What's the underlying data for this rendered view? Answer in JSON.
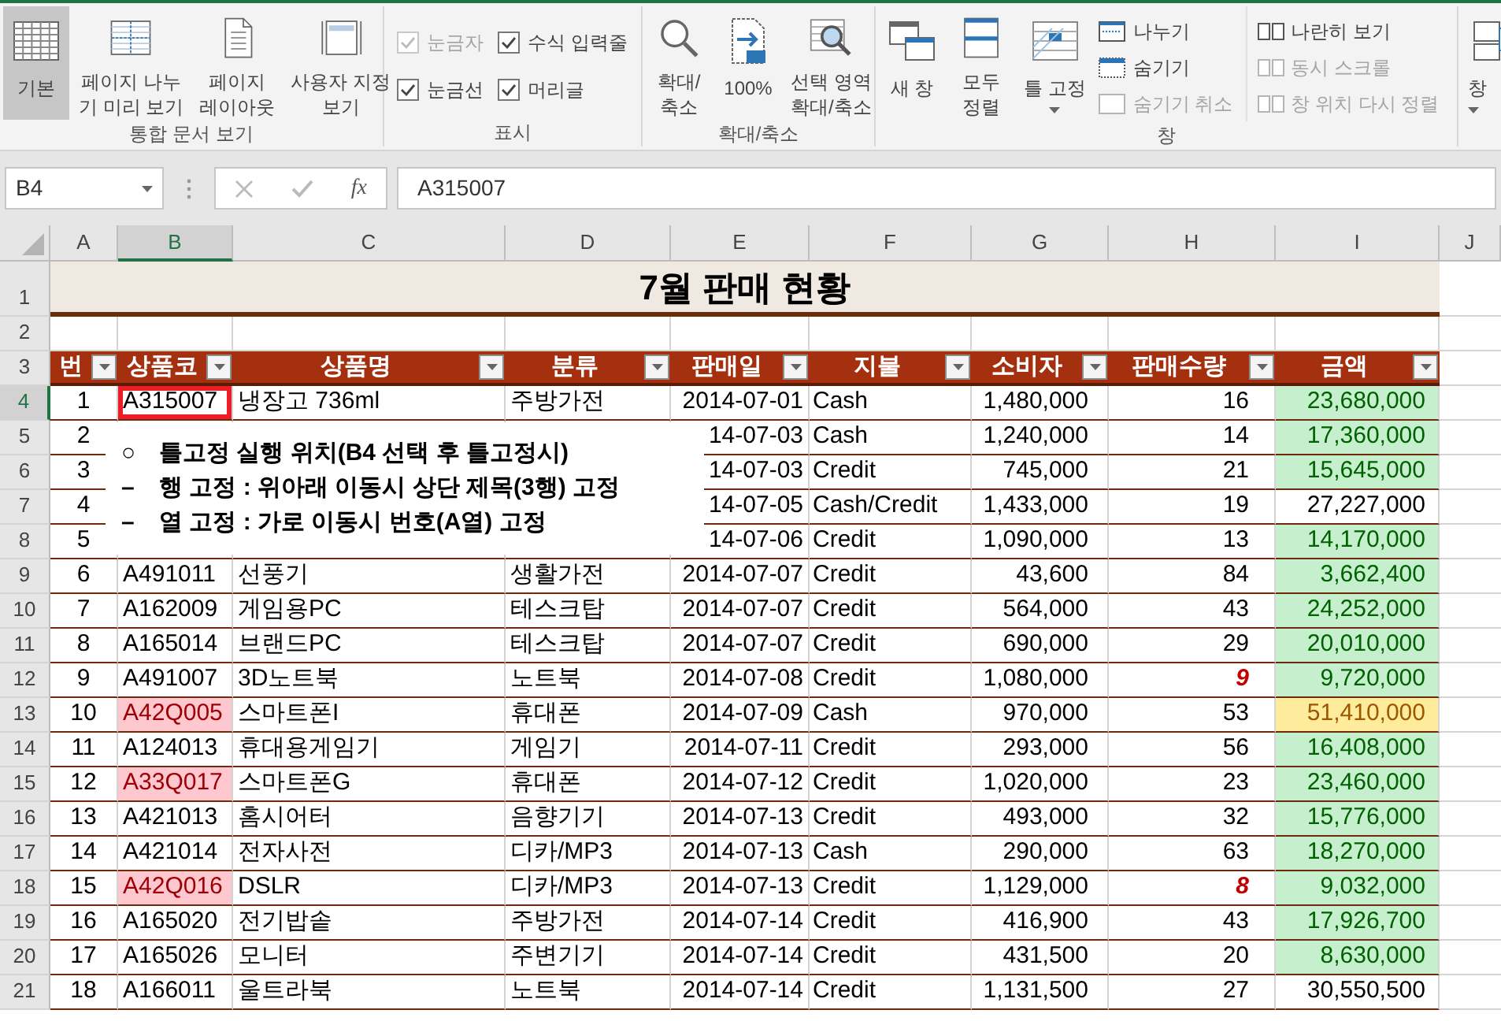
{
  "ribbon": {
    "groups": [
      {
        "label": "통합 문서 보기",
        "items": [
          {
            "kind": "large",
            "lines": [
              "기본"
            ],
            "selected": true,
            "has_menu": false
          },
          {
            "kind": "large",
            "lines": [
              "페이지 나누",
              "기 미리 보기"
            ],
            "selected": false,
            "has_menu": false
          },
          {
            "kind": "large",
            "lines": [
              "페이지",
              "레이아웃"
            ],
            "selected": false,
            "has_menu": false
          },
          {
            "kind": "large",
            "lines": [
              "사용자 지정",
              "보기"
            ],
            "selected": false,
            "has_menu": false
          }
        ]
      },
      {
        "label": "표시",
        "items": [
          {
            "kind": "check",
            "label": "눈금자",
            "checked": true,
            "disabled": true
          },
          {
            "kind": "check",
            "label": "수식 입력줄",
            "checked": true,
            "disabled": false
          },
          {
            "kind": "check",
            "label": "눈금선",
            "checked": true,
            "disabled": false
          },
          {
            "kind": "check",
            "label": "머리글",
            "checked": true,
            "disabled": false
          }
        ]
      },
      {
        "label": "확대/축소",
        "items": [
          {
            "kind": "large",
            "lines": [
              "확대/",
              "축소"
            ],
            "selected": false,
            "has_menu": false
          },
          {
            "kind": "large",
            "lines": [
              "100%"
            ],
            "selected": false,
            "has_menu": false
          },
          {
            "kind": "large",
            "lines": [
              "선택 영역",
              "확대/축소"
            ],
            "selected": false,
            "has_menu": false
          }
        ]
      },
      {
        "label": "창",
        "items": [
          {
            "kind": "large",
            "lines": [
              "새 창"
            ],
            "selected": false,
            "has_menu": false
          },
          {
            "kind": "large",
            "lines": [
              "모두",
              "정렬"
            ],
            "selected": false,
            "has_menu": false
          },
          {
            "kind": "large",
            "lines": [
              "틀 고정"
            ],
            "selected": false,
            "has_menu": true
          },
          {
            "kind": "small",
            "label": "나누기",
            "disabled": false
          },
          {
            "kind": "small",
            "label": "숨기기",
            "disabled": false
          },
          {
            "kind": "small",
            "label": "숨기기 취소",
            "disabled": true
          },
          {
            "kind": "small",
            "label": "나란히 보기",
            "disabled": false
          },
          {
            "kind": "small",
            "label": "동시 스크롤",
            "disabled": true
          },
          {
            "kind": "small",
            "label": "창 위치 다시 정렬",
            "disabled": true
          }
        ]
      },
      {
        "items": [
          {
            "kind": "large",
            "lines": [
              "창"
            ],
            "selected": false,
            "has_menu": true
          }
        ]
      }
    ]
  },
  "formula_bar": {
    "name_box": "B4",
    "insert_function": "fx",
    "value": "A315007"
  },
  "sheet": {
    "columns": [
      {
        "label": "A",
        "selected": false
      },
      {
        "label": "B",
        "selected": true
      },
      {
        "label": "C",
        "selected": false
      },
      {
        "label": "D",
        "selected": false
      },
      {
        "label": "E",
        "selected": false
      },
      {
        "label": "F",
        "selected": false
      },
      {
        "label": "G",
        "selected": false
      },
      {
        "label": "H",
        "selected": false
      },
      {
        "label": "I",
        "selected": false
      },
      {
        "label": "J",
        "selected": false
      }
    ],
    "title_row": {
      "row": "1",
      "title": "7월 판매 현황"
    },
    "blank_row": {
      "row": "2"
    },
    "header_row": {
      "row": "3",
      "headers": [
        "번",
        "상품코",
        "상품명",
        "분류",
        "판매일",
        "지불",
        "소비자",
        "판매수량",
        "금액"
      ]
    },
    "rows": [
      {
        "row": "4",
        "selected": true,
        "no": "1",
        "code": "A315007",
        "name": "냉장고 736ml",
        "category": "주방가전",
        "date": "2014-07-01",
        "payment": "Cash",
        "price": "1,480,000",
        "qty": "16",
        "amount": "23,680,000",
        "code_selected": true,
        "code_flagged": false,
        "qty_low": false,
        "amount_ok": true,
        "amount_top": false
      },
      {
        "row": "5",
        "selected": false,
        "no": "2",
        "date": "14-07-03",
        "payment": "Cash",
        "price": "1,240,000",
        "qty": "14",
        "amount": "17,360,000",
        "qty_low": false,
        "amount_ok": true,
        "amount_top": false
      },
      {
        "row": "6",
        "selected": false,
        "no": "3",
        "date": "14-07-03",
        "payment": "Credit",
        "price": "745,000",
        "qty": "21",
        "amount": "15,645,000",
        "qty_low": false,
        "amount_ok": true,
        "amount_top": false
      },
      {
        "row": "7",
        "selected": false,
        "no": "4",
        "date": "14-07-05",
        "payment": "Cash/Credit",
        "price": "1,433,000",
        "qty": "19",
        "amount": "27,227,000",
        "qty_low": false,
        "amount_ok": false,
        "amount_top": false
      },
      {
        "row": "8",
        "selected": false,
        "no": "5",
        "date": "14-07-06",
        "payment": "Credit",
        "price": "1,090,000",
        "qty": "13",
        "amount": "14,170,000",
        "qty_low": false,
        "amount_ok": true,
        "amount_top": false
      },
      {
        "row": "9",
        "selected": false,
        "no": "6",
        "code": "A491011",
        "name": "선풍기",
        "category": "생활가전",
        "date": "2014-07-07",
        "payment": "Credit",
        "price": "43,600",
        "qty": "84",
        "amount": "3,662,400",
        "code_selected": false,
        "code_flagged": false,
        "qty_low": false,
        "amount_ok": true,
        "amount_top": false
      },
      {
        "row": "10",
        "selected": false,
        "no": "7",
        "code": "A162009",
        "name": "게임용PC",
        "category": "테스크탑",
        "date": "2014-07-07",
        "payment": "Credit",
        "price": "564,000",
        "qty": "43",
        "amount": "24,252,000",
        "code_selected": false,
        "code_flagged": false,
        "qty_low": false,
        "amount_ok": true,
        "amount_top": false
      },
      {
        "row": "11",
        "selected": false,
        "no": "8",
        "code": "A165014",
        "name": "브랜드PC",
        "category": "테스크탑",
        "date": "2014-07-07",
        "payment": "Credit",
        "price": "690,000",
        "qty": "29",
        "amount": "20,010,000",
        "code_selected": false,
        "code_flagged": false,
        "qty_low": false,
        "amount_ok": true,
        "amount_top": false
      },
      {
        "row": "12",
        "selected": false,
        "no": "9",
        "code": "A491007",
        "name": "3D노트북",
        "category": "노트북",
        "date": "2014-07-08",
        "payment": "Credit",
        "price": "1,080,000",
        "qty": "9",
        "amount": "9,720,000",
        "code_selected": false,
        "code_flagged": false,
        "qty_low": true,
        "amount_ok": true,
        "amount_top": false
      },
      {
        "row": "13",
        "selected": false,
        "no": "10",
        "code": "A42Q005",
        "name": "스마트폰I",
        "category": "휴대폰",
        "date": "2014-07-09",
        "payment": "Cash",
        "price": "970,000",
        "qty": "53",
        "amount": "51,410,000",
        "code_selected": false,
        "code_flagged": true,
        "qty_low": false,
        "amount_top": true
      },
      {
        "row": "14",
        "selected": false,
        "no": "11",
        "code": "A124013",
        "name": "휴대용게임기",
        "category": "게임기",
        "date": "2014-07-11",
        "payment": "Credit",
        "price": "293,000",
        "qty": "56",
        "amount": "16,408,000",
        "code_selected": false,
        "code_flagged": false,
        "qty_low": false,
        "amount_ok": true,
        "amount_top": false
      },
      {
        "row": "15",
        "selected": false,
        "no": "12",
        "code": "A33Q017",
        "name": "스마트폰G",
        "category": "휴대폰",
        "date": "2014-07-12",
        "payment": "Credit",
        "price": "1,020,000",
        "qty": "23",
        "amount": "23,460,000",
        "code_selected": false,
        "code_flagged": true,
        "qty_low": false,
        "amount_ok": true,
        "amount_top": false
      },
      {
        "row": "16",
        "selected": false,
        "no": "13",
        "code": "A421013",
        "name": "홈시어터",
        "category": "음향기기",
        "date": "2014-07-13",
        "payment": "Credit",
        "price": "493,000",
        "qty": "32",
        "amount": "15,776,000",
        "code_selected": false,
        "code_flagged": false,
        "qty_low": false,
        "amount_ok": true,
        "amount_top": false
      },
      {
        "row": "17",
        "selected": false,
        "no": "14",
        "code": "A421014",
        "name": "전자사전",
        "category": "디카/MP3",
        "date": "2014-07-13",
        "payment": "Cash",
        "price": "290,000",
        "qty": "63",
        "amount": "18,270,000",
        "code_selected": false,
        "code_flagged": false,
        "qty_low": false,
        "amount_ok": true,
        "amount_top": false
      },
      {
        "row": "18",
        "selected": false,
        "no": "15",
        "code": "A42Q016",
        "name": "DSLR",
        "category": "디카/MP3",
        "date": "2014-07-13",
        "payment": "Credit",
        "price": "1,129,000",
        "qty": "8",
        "amount": "9,032,000",
        "code_selected": false,
        "code_flagged": true,
        "qty_low": true,
        "amount_ok": true,
        "amount_top": false
      },
      {
        "row": "19",
        "selected": false,
        "no": "16",
        "code": "A165020",
        "name": "전기밥솥",
        "category": "주방가전",
        "date": "2014-07-14",
        "payment": "Credit",
        "price": "416,900",
        "qty": "43",
        "amount": "17,926,700",
        "code_selected": false,
        "code_flagged": false,
        "qty_low": false,
        "amount_ok": true,
        "amount_top": false
      },
      {
        "row": "20",
        "selected": false,
        "no": "17",
        "code": "A165026",
        "name": "모니터",
        "category": "주변기기",
        "date": "2014-07-14",
        "payment": "Credit",
        "price": "431,500",
        "qty": "20",
        "amount": "8,630,000",
        "code_selected": false,
        "code_flagged": false,
        "qty_low": false,
        "amount_ok": true,
        "amount_top": false
      },
      {
        "row": "21",
        "selected": false,
        "no": "18",
        "code": "A166011",
        "name": "울트라북",
        "category": "노트북",
        "date": "2014-07-14",
        "payment": "Credit",
        "price": "1,131,500",
        "qty": "27",
        "amount": "30,550,500",
        "code_selected": false,
        "code_flagged": false,
        "qty_low": false,
        "amount_ok": false,
        "amount_top": false
      }
    ],
    "note": [
      {
        "bullet": "○",
        "text": "틀고정 실행 위치(B4 선택 후 틀고정시)"
      },
      {
        "bullet": "–",
        "text": "행 고정 : 위아래 이동시 상단 제목(3행) 고정"
      },
      {
        "bullet": "–",
        "text": "열 고정 : 가로 이동시 번호(A열) 고정"
      }
    ]
  }
}
